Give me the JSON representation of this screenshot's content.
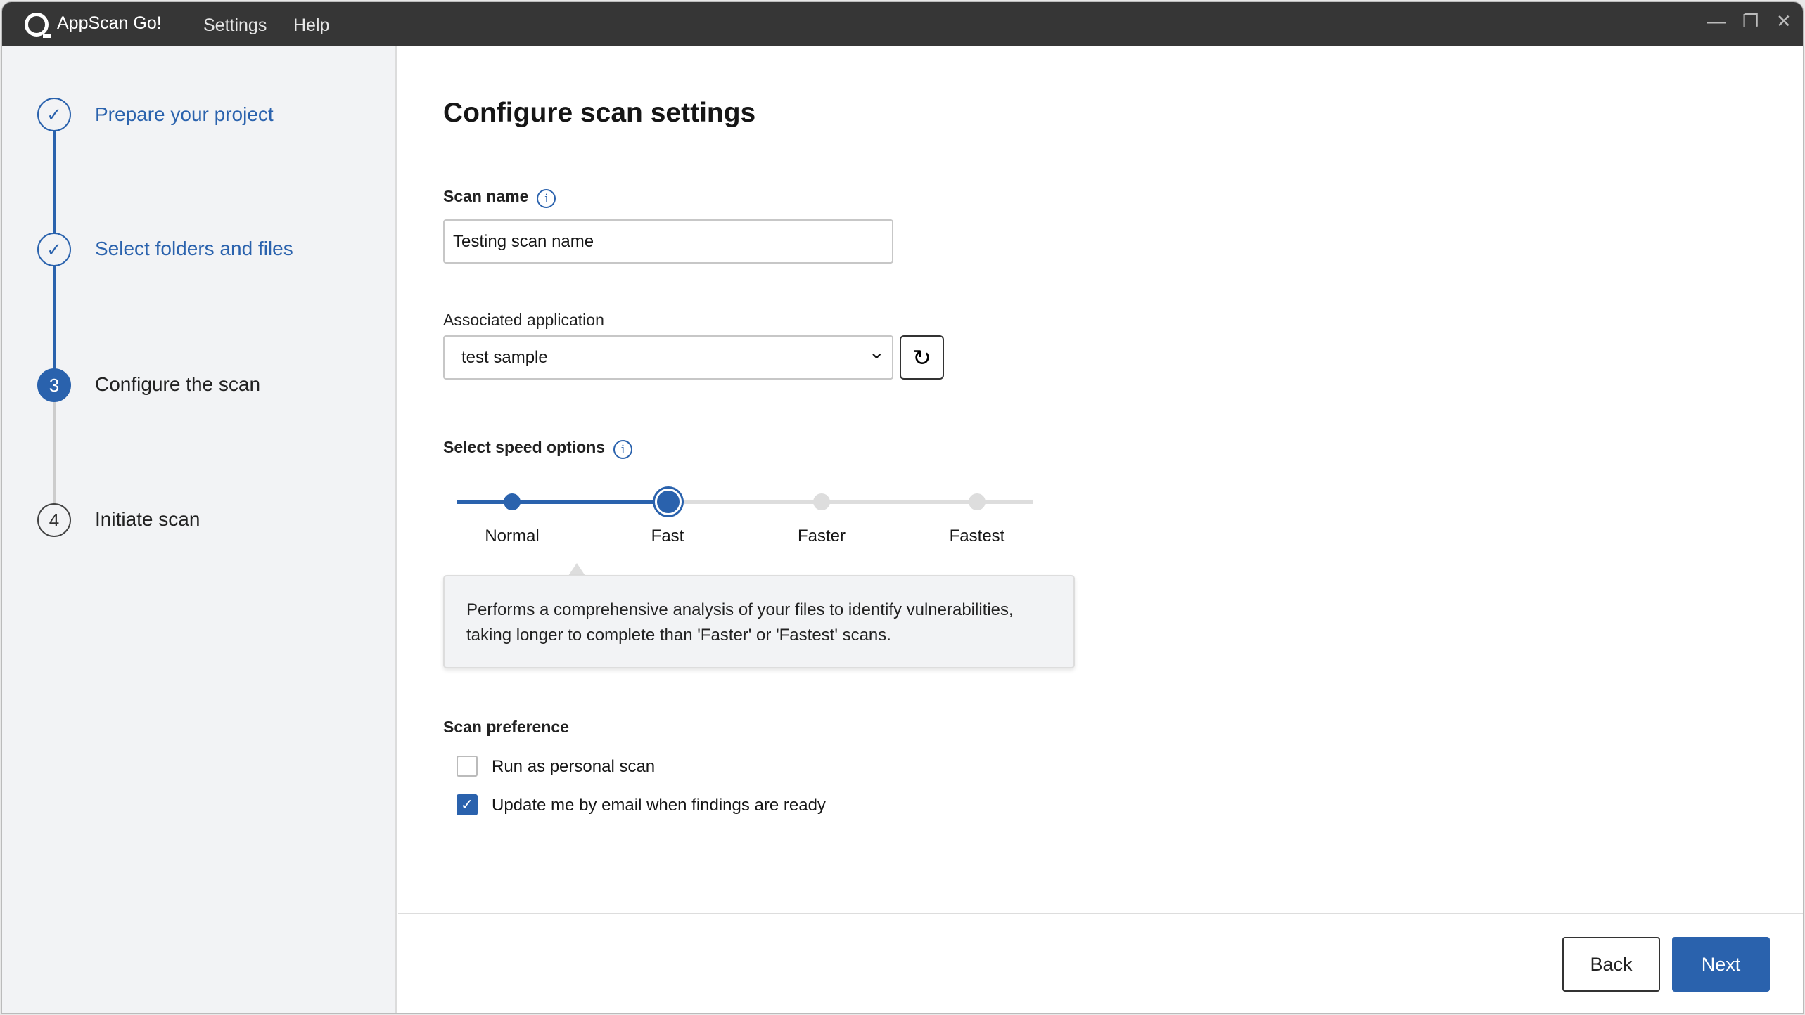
{
  "titlebar": {
    "app_name": "AppScan Go!",
    "menu": [
      "Settings",
      "Help"
    ],
    "controls": {
      "minimize": "—",
      "maximize": "❐",
      "close": "✕"
    }
  },
  "steps": [
    {
      "label": "Prepare your project",
      "state": "done",
      "marker": "✓"
    },
    {
      "label": "Select folders and files",
      "state": "done",
      "marker": "✓"
    },
    {
      "label": "Configure the scan",
      "state": "active",
      "marker": "3"
    },
    {
      "label": "Initiate scan",
      "state": "todo",
      "marker": "4"
    }
  ],
  "main": {
    "title": "Configure scan settings",
    "scan_name": {
      "label": "Scan name",
      "value": "Testing scan name",
      "info_icon": "i"
    },
    "associated_application": {
      "label": "Associated application",
      "selected": "test sample",
      "refresh_icon": "↻",
      "chevron": "⌄"
    },
    "speed": {
      "label": "Select speed options",
      "info_icon": "i",
      "options": [
        "Normal",
        "Fast",
        "Faster",
        "Fastest"
      ],
      "selected": "Fast",
      "description": "Performs a comprehensive analysis of your files to identify vulnerabilities, taking longer to complete than 'Faster' or 'Fastest' scans."
    },
    "preference": {
      "label": "Scan preference",
      "options": [
        {
          "label": "Run as personal scan",
          "checked": false
        },
        {
          "label": "Update me by email when findings are ready",
          "checked": true
        }
      ]
    }
  },
  "footer": {
    "back": "Back",
    "next": "Next"
  },
  "colors": {
    "accent": "#2a62ad",
    "titlebar": "#363636",
    "sidebar": "#f2f3f5"
  }
}
